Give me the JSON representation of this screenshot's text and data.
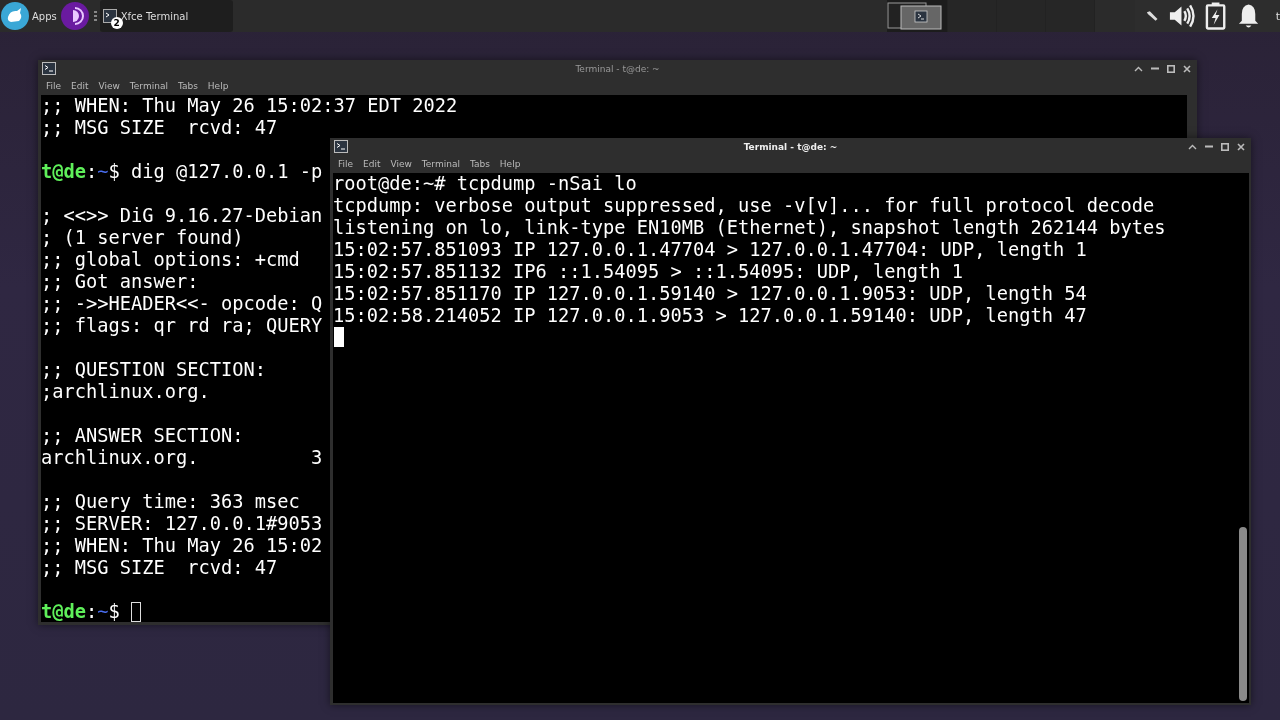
{
  "panel": {
    "apps_label": "Apps",
    "tasks": [
      {
        "label": "Xfce Terminal",
        "badge": "2",
        "selected": true
      }
    ],
    "workspaces": [
      {
        "selected": true
      },
      {
        "selected": false
      },
      {
        "selected": false
      },
      {
        "selected": false
      }
    ],
    "clock": "t"
  },
  "windows": [
    {
      "title": "Terminal - t@de: ~",
      "focused": false,
      "menu": [
        "File",
        "Edit",
        "View",
        "Terminal",
        "Tabs",
        "Help"
      ],
      "lines": [
        {
          "kind": "text",
          "text": ";; WHEN: Thu May 26 15:02:37 EDT 2022"
        },
        {
          "kind": "text",
          "text": ";; MSG SIZE  rcvd: 47"
        },
        {
          "kind": "blank"
        },
        {
          "kind": "prompt",
          "user": "t@de",
          "sep": ":",
          "path": "~",
          "symbol": "$",
          "command": "dig @127.0.0.1 -p"
        },
        {
          "kind": "blank"
        },
        {
          "kind": "text",
          "text": "; <<>> DiG 9.16.27-Debian"
        },
        {
          "kind": "text",
          "text": "; (1 server found)"
        },
        {
          "kind": "text",
          "text": ";; global options: +cmd"
        },
        {
          "kind": "text",
          "text": ";; Got answer:"
        },
        {
          "kind": "text",
          "text": ";; ->>HEADER<<- opcode: Q"
        },
        {
          "kind": "text",
          "text": ";; flags: qr rd ra; QUERY"
        },
        {
          "kind": "blank"
        },
        {
          "kind": "text",
          "text": ";; QUESTION SECTION:"
        },
        {
          "kind": "text",
          "text": ";archlinux.org."
        },
        {
          "kind": "blank"
        },
        {
          "kind": "text",
          "text": ";; ANSWER SECTION:"
        },
        {
          "kind": "text",
          "text": "archlinux.org.          3"
        },
        {
          "kind": "blank"
        },
        {
          "kind": "text",
          "text": ";; Query time: 363 msec"
        },
        {
          "kind": "text",
          "text": ";; SERVER: 127.0.0.1#9053"
        },
        {
          "kind": "text",
          "text": ";; WHEN: Thu May 26 15:02"
        },
        {
          "kind": "text",
          "text": ";; MSG SIZE  rcvd: 47"
        },
        {
          "kind": "blank"
        },
        {
          "kind": "prompt",
          "user": "t@de",
          "sep": ":",
          "path": "~",
          "symbol": "$",
          "cursor": true
        }
      ]
    },
    {
      "title": "Terminal - t@de: ~",
      "focused": true,
      "menu": [
        "File",
        "Edit",
        "View",
        "Terminal",
        "Tabs",
        "Help"
      ],
      "lines": [
        {
          "kind": "text",
          "text": "root@de:~# tcpdump -nSai lo"
        },
        {
          "kind": "text",
          "text": "tcpdump: verbose output suppressed, use -v[v]... for full protocol decode"
        },
        {
          "kind": "text",
          "text": "listening on lo, link-type EN10MB (Ethernet), snapshot length 262144 bytes"
        },
        {
          "kind": "text",
          "text": "15:02:57.851093 IP 127.0.0.1.47704 > 127.0.0.1.47704: UDP, length 1"
        },
        {
          "kind": "text",
          "text": "15:02:57.851132 IP6 ::1.54095 > ::1.54095: UDP, length 1"
        },
        {
          "kind": "text",
          "text": "15:02:57.851170 IP 127.0.0.1.59140 > 127.0.0.1.9053: UDP, length 54"
        },
        {
          "kind": "text",
          "text": "15:02:58.214052 IP 127.0.0.1.9053 > 127.0.0.1.59140: UDP, length 47"
        },
        {
          "kind": "cursor",
          "cursor": true
        }
      ]
    }
  ]
}
